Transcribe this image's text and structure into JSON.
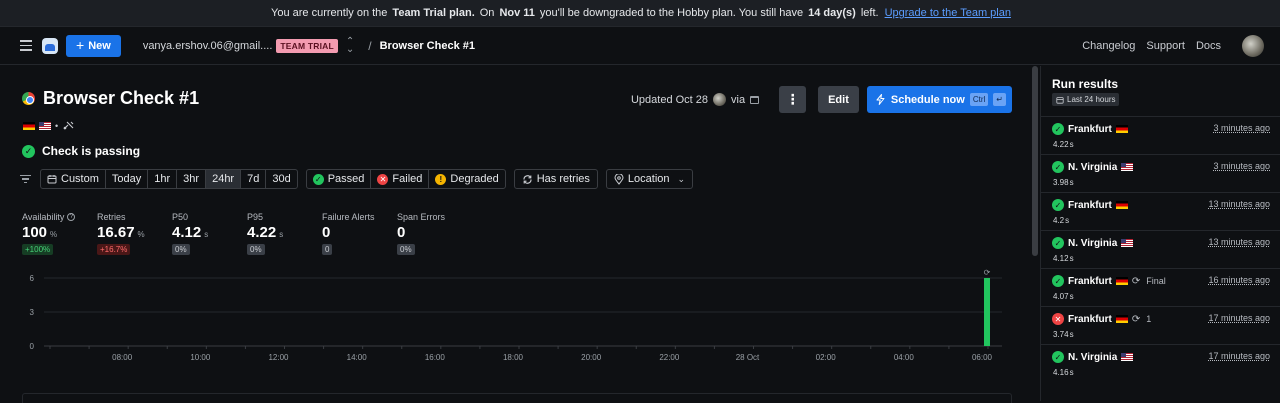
{
  "banner": {
    "pre": "You are currently on the",
    "plan": "Team Trial plan.",
    "on": "On",
    "date": "Nov 11",
    "mid": "you'll be downgraded to the Hobby plan. You still have",
    "days": "14 day(s)",
    "left": "left.",
    "link": "Upgrade to the Team plan"
  },
  "topnav": {
    "new_label": "New",
    "account": "vanya.ershov.06@gmail....",
    "trial_badge": "TEAM TRIAL",
    "separator": "/",
    "breadcrumb": "Browser Check #1",
    "links": [
      "Changelog",
      "Support",
      "Docs"
    ]
  },
  "check": {
    "title": "Browser Check #1",
    "bullet": "•",
    "status": "Check is passing",
    "updated": "Updated Oct 28",
    "via": "via",
    "more_label": "⋮",
    "edit_label": "Edit",
    "schedule_label": "Schedule now",
    "kbd_ctrl": "Ctrl",
    "kbd_enter": "↵"
  },
  "filters": {
    "time_ranges": [
      "Custom",
      "Today",
      "1hr",
      "3hr",
      "24hr",
      "7d",
      "30d"
    ],
    "active_range": "24hr",
    "status": [
      "Passed",
      "Failed",
      "Degraded"
    ],
    "retries": "Has retries",
    "location": "Location"
  },
  "stats": [
    {
      "label": "Availability",
      "value": "100",
      "unit": "%",
      "change": "+100%",
      "trend": "up"
    },
    {
      "label": "Retries",
      "value": "16.67",
      "unit": "%",
      "change": "+16.7%",
      "trend": "down"
    },
    {
      "label": "P50",
      "value": "4.12",
      "unit": "s",
      "change": "0%",
      "trend": "flat"
    },
    {
      "label": "P95",
      "value": "4.22",
      "unit": "s",
      "change": "0%",
      "trend": "flat"
    },
    {
      "label": "Failure Alerts",
      "value": "0",
      "unit": "",
      "change": "0",
      "trend": "flat"
    },
    {
      "label": "Span Errors",
      "value": "0",
      "unit": "",
      "change": "0%",
      "trend": "flat"
    }
  ],
  "chart_data": {
    "type": "bar",
    "x_ticks": [
      "08:00",
      "10:00",
      "12:00",
      "14:00",
      "16:00",
      "18:00",
      "20:00",
      "22:00",
      "28 Oct",
      "02:00",
      "04:00",
      "06:00"
    ],
    "y_ticks": [
      "6",
      "3",
      "0"
    ],
    "ylim": [
      0,
      6
    ],
    "series": [
      {
        "name": "Passed",
        "color": "#22c55e",
        "points": [
          {
            "x": "06:30",
            "value": 6
          }
        ]
      }
    ]
  },
  "run_results": {
    "title": "Run results",
    "range": "Last 24 hours",
    "items": [
      {
        "status": "passed",
        "location": "Frankfurt",
        "flag": "de",
        "note": "",
        "duration": "4.22",
        "unit": "s",
        "time": "3 minutes ago"
      },
      {
        "status": "passed",
        "location": "N. Virginia",
        "flag": "us",
        "note": "",
        "duration": "3.98",
        "unit": "s",
        "time": "3 minutes ago"
      },
      {
        "status": "passed",
        "location": "Frankfurt",
        "flag": "de",
        "note": "",
        "duration": "4.2",
        "unit": "s",
        "time": "13 minutes ago"
      },
      {
        "status": "passed",
        "location": "N. Virginia",
        "flag": "us",
        "note": "",
        "duration": "4.12",
        "unit": "s",
        "time": "13 minutes ago"
      },
      {
        "status": "passed",
        "location": "Frankfurt",
        "flag": "de",
        "note": "Final",
        "duration": "4.07",
        "unit": "s",
        "time": "16 minutes ago"
      },
      {
        "status": "failed",
        "location": "Frankfurt",
        "flag": "de",
        "note": "1",
        "duration": "3.74",
        "unit": "s",
        "time": "17 minutes ago"
      },
      {
        "status": "passed",
        "location": "N. Virginia",
        "flag": "us",
        "note": "",
        "duration": "4.16",
        "unit": "s",
        "time": "17 minutes ago"
      }
    ]
  },
  "colors": {
    "accent": "#1a73e8",
    "pass": "#22c55e",
    "fail": "#ef4444",
    "warn": "#f5b400",
    "trial_badge": "#f39bb0"
  }
}
